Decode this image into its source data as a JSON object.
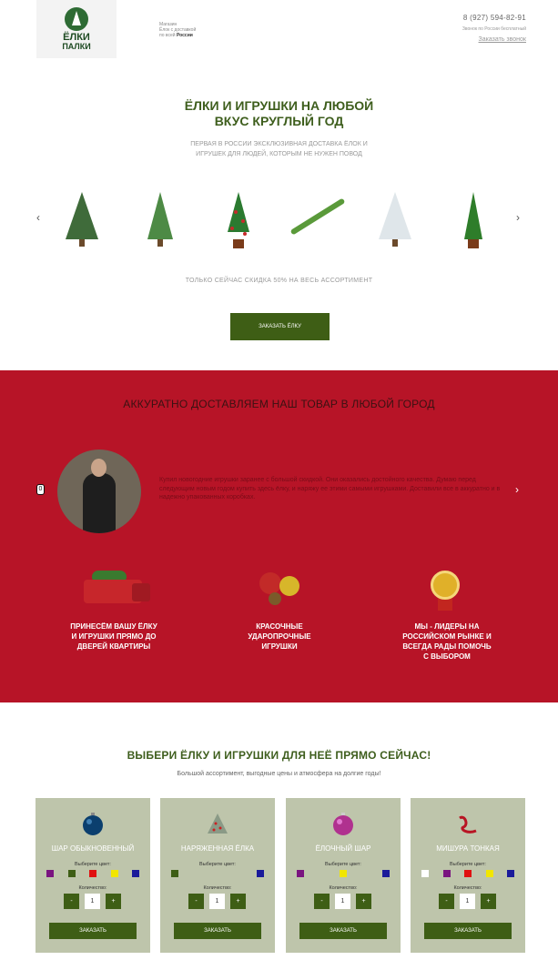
{
  "header": {
    "logo_line1": "ЁЛКИ",
    "logo_line2": "ПАЛКИ",
    "desc_line1": "Магазин",
    "desc_line2": "Ёлок с доставкой",
    "desc_line3": "по всей",
    "desc_country": "России",
    "phone": "8 (927) 594-82-91",
    "phone_note": "Звонок по России бесплатный",
    "callback": "Заказать звонок"
  },
  "hero": {
    "title_line1": "ЁЛКИ И ИГРУШКИ НА ЛЮБОЙ",
    "title_line2": "ВКУС КРУГЛЫЙ ГОД",
    "subtitle_line1": "ПЕРВАЯ В РОССИИ ЭКСКЛЮЗИВНАЯ ДОСТАВКА ЁЛОК И",
    "subtitle_line2": "ИГРУШЕК ДЛЯ ЛЮДЕЙ, КОТОРЫМ НЕ НУЖЕН ПОВОД",
    "prev_arrow": "‹",
    "next_arrow": "›",
    "discount": "ТОЛЬКО СЕЙЧАС СКИДКА 50% НА ВЕСЬ АССОРТИМЕНТ",
    "order_button": "ЗАКАЗАТЬ ЁЛКУ"
  },
  "delivery": {
    "title": "АККУРАТНО ДОСТАВЛЯЕМ НАШ ТОВАР В ЛЮБОЙ ГОРОД",
    "prev_marker": "0",
    "next_arrow": "›",
    "review": "Купил новогодние игрушки заранее с большой скидкой. Они оказались достойного качества. Думаю перед следующим новым годом купить здесь ёлку, и наряжу ее этими самыми игрушками. Доставили все в аккуратно и в надежно упакованных коробках.",
    "features": [
      {
        "line1": "ПРИНЕСЁМ ВАШУ ЁЛКУ",
        "line2": "И ИГРУШКИ ПРЯМО ДО",
        "line3": "ДВЕРЕЙ КВАРТИРЫ",
        "line4": ""
      },
      {
        "line1": "КРАСОЧНЫЕ",
        "line2": "УДАРОПРОЧНЫЕ",
        "line3": "ИГРУШКИ",
        "line4": ""
      },
      {
        "line1": "МЫ - ЛИДЕРЫ НА",
        "line2": "РОССИЙСКОМ РЫНКЕ И",
        "line3": "ВСЕГДА РАДЫ ПОМОЧЬ",
        "line4": "С ВЫБОРОМ"
      }
    ]
  },
  "catalog": {
    "title": "ВЫБЕРИ ЁЛКУ И ИГРУШКИ ДЛЯ НЕЁ ПРЯМО СЕЙЧАС!",
    "subtitle": "Большой ассортимент, выгодные цены и атмосфера на долгие годы!",
    "color_label": "Выберите цвет:",
    "qty_label": "Количество:",
    "minus": "-",
    "plus": "+",
    "qty_value": "1",
    "order_label": "ЗАКАЗАТЬ",
    "cards": [
      {
        "name": "ШАР ОБЫКНОВЕННЫЙ",
        "icon": "blue-ball-icon",
        "colors": [
          "#7a1480",
          "#3e5e15",
          "#e01010",
          "#f2e600",
          "#1a1a9a"
        ]
      },
      {
        "name": "НАРЯЖЕННАЯ ЁЛКА",
        "icon": "decorated-tree-icon",
        "colors": [
          "#3e5e15",
          "#1a1a9a"
        ]
      },
      {
        "name": "ЁЛОЧНЫЙ ШАР",
        "icon": "pink-ball-icon",
        "colors": [
          "#7a1480",
          "#f2e600",
          "#1a1a9a"
        ]
      },
      {
        "name": "МИШУРА ТОНКАЯ",
        "icon": "tinsel-icon",
        "colors": [
          "#ffffff",
          "#7a1480",
          "#e01010",
          "#f2e600",
          "#1a1a9a"
        ]
      }
    ]
  }
}
